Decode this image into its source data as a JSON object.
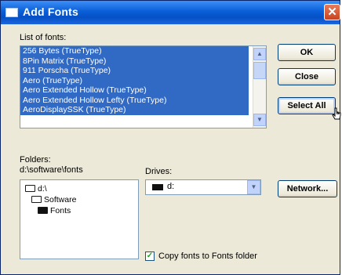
{
  "window": {
    "title": "Add Fonts",
    "close_glyph": "✕"
  },
  "fonts_list": {
    "label": "List of fonts:",
    "items": [
      "256 Bytes (TrueType)",
      "8Pin Matrix (TrueType)",
      "911 Porscha (TrueType)",
      "Aero (TrueType)",
      "Aero Extended Hollow (TrueType)",
      "Aero Extended Hollow Lefty (TrueType)",
      "AeroDisplaySSK (TrueType)"
    ],
    "scroll_up_glyph": "▲",
    "scroll_down_glyph": "▼"
  },
  "buttons": {
    "ok": "OK",
    "close": "Close",
    "select_all": "Select All",
    "network": "Network..."
  },
  "folders": {
    "label": "Folders:",
    "path": "d:\\software\\fonts",
    "tree": [
      "d:\\",
      "Software",
      "Fonts"
    ]
  },
  "drives": {
    "label": "Drives:",
    "selected": "d:",
    "dropdown_glyph": "▼"
  },
  "copy_option": {
    "label": "Copy fonts to Fonts folder",
    "checked": true,
    "check_glyph": "✓"
  },
  "colors": {
    "title_bar": "#0a5fd8",
    "selection": "#316ac5",
    "dialog_face": "#ece9d8",
    "close_button": "#c8441f"
  },
  "icons": [
    "window-icon",
    "close-icon",
    "folder-open-icon",
    "folder-icon",
    "drive-icon",
    "check-icon",
    "cursor-icon"
  ]
}
